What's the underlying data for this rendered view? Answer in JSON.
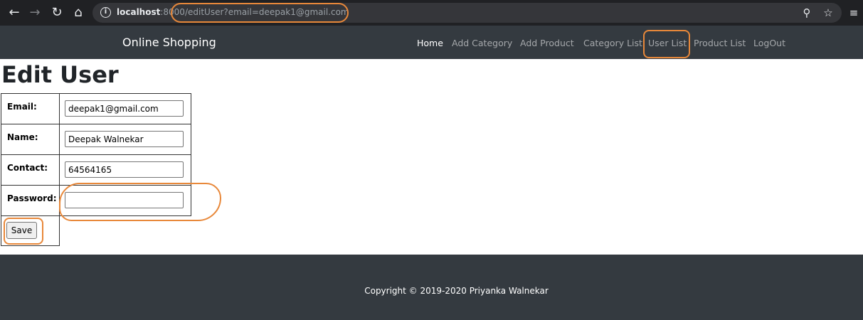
{
  "browser": {
    "url_host": "localhost",
    "url_port": ":8000",
    "url_path": "/editUser?email=deepak1@gmail.com"
  },
  "navbar": {
    "brand": "Online Shopping",
    "links": [
      {
        "label": "Home"
      },
      {
        "label": "Add Category"
      },
      {
        "label": "Add Product"
      },
      {
        "label": "Category List"
      },
      {
        "label": "User List"
      },
      {
        "label": "Product List"
      },
      {
        "label": "LogOut"
      }
    ]
  },
  "main": {
    "title": "Edit User",
    "fields": [
      {
        "label": "Email:",
        "value": "deepak1@gmail.com"
      },
      {
        "label": "Name:",
        "value": "Deepak Walnekar"
      },
      {
        "label": "Contact:",
        "value": "64564165"
      },
      {
        "label": "Password:",
        "value": ""
      }
    ],
    "save_label": "Save"
  },
  "footer": {
    "text": "Copyright © 2019-2020 Priyanka Walnekar"
  },
  "colors": {
    "navbar_bg": "#343a40",
    "highlight": "#e8883a"
  }
}
